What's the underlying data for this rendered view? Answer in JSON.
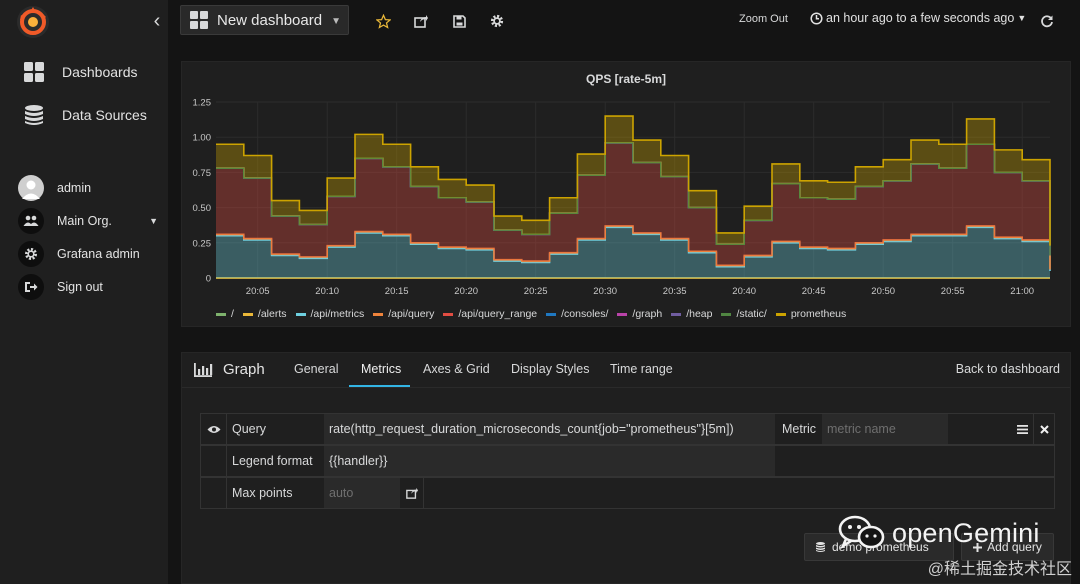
{
  "sidebar": {
    "nav": [
      {
        "label": "Dashboards",
        "icon": "dashboards-grid-icon"
      },
      {
        "label": "Data Sources",
        "icon": "database-icon"
      }
    ],
    "user": [
      {
        "label": "admin",
        "icon": "avatar"
      },
      {
        "label": "Main Org.",
        "icon": "users-icon"
      },
      {
        "label": "Grafana admin",
        "icon": "gear-icon"
      },
      {
        "label": "Sign out",
        "icon": "sign-out-icon"
      }
    ]
  },
  "topbar": {
    "dashboard_title": "New dashboard",
    "zoom_out": "Zoom Out",
    "time_range": "an hour ago to a few seconds ago"
  },
  "panel": {
    "title": "QPS [rate-5m]"
  },
  "chart_data": {
    "type": "area",
    "title": "QPS [rate-5m]",
    "stacked": true,
    "grid": true,
    "legend_position": "bottom",
    "ylim": [
      0,
      1.25
    ],
    "y_ticks": [
      "0",
      "0.25",
      "0.50",
      "0.75",
      "1.00",
      "1.25"
    ],
    "x_ticks": [
      "20:05",
      "20:10",
      "20:15",
      "20:20",
      "20:25",
      "20:30",
      "20:35",
      "20:40",
      "20:45",
      "20:50",
      "20:55",
      "21:00"
    ],
    "x": [
      "20:02",
      "20:04",
      "20:06",
      "20:08",
      "20:10",
      "20:12",
      "20:14",
      "20:16",
      "20:18",
      "20:20",
      "20:22",
      "20:24",
      "20:26",
      "20:28",
      "20:30",
      "20:32",
      "20:34",
      "20:36",
      "20:38",
      "20:40",
      "20:42",
      "20:44",
      "20:46",
      "20:48",
      "20:50",
      "20:52",
      "20:54",
      "20:56",
      "20:58",
      "21:00",
      "21:02"
    ],
    "series": [
      {
        "name": "/",
        "color": "#7eb26d",
        "values": [
          0,
          0,
          0,
          0,
          0,
          0,
          0,
          0,
          0,
          0,
          0,
          0,
          0,
          0,
          0,
          0,
          0,
          0,
          0,
          0,
          0,
          0,
          0,
          0,
          0,
          0,
          0,
          0,
          0,
          0,
          0
        ]
      },
      {
        "name": "/alerts",
        "color": "#eab839",
        "values": [
          0,
          0,
          0,
          0,
          0,
          0,
          0,
          0,
          0,
          0,
          0,
          0,
          0,
          0,
          0,
          0,
          0,
          0,
          0,
          0,
          0,
          0,
          0,
          0,
          0,
          0,
          0,
          0,
          0,
          0,
          0
        ]
      },
      {
        "name": "/api/metrics",
        "color": "#6ed0e0",
        "values": [
          0.3,
          0.27,
          0.16,
          0.14,
          0.22,
          0.32,
          0.3,
          0.24,
          0.21,
          0.2,
          0.12,
          0.11,
          0.17,
          0.27,
          0.36,
          0.31,
          0.27,
          0.18,
          0.08,
          0.15,
          0.25,
          0.21,
          0.2,
          0.24,
          0.26,
          0.3,
          0.3,
          0.36,
          0.28,
          0.26,
          0.05
        ]
      },
      {
        "name": "/api/query",
        "color": "#ef843c",
        "values": [
          0.01,
          0.01,
          0.01,
          0.01,
          0.01,
          0.01,
          0.01,
          0.01,
          0.01,
          0.01,
          0.01,
          0.01,
          0.01,
          0.01,
          0.01,
          0.01,
          0.01,
          0.01,
          0.01,
          0.01,
          0.01,
          0.01,
          0.01,
          0.01,
          0.01,
          0.01,
          0.01,
          0.01,
          0.01,
          0.01,
          0.01
        ]
      },
      {
        "name": "/api/query_range",
        "color": "#e24d42",
        "values": [
          0.47,
          0.43,
          0.27,
          0.23,
          0.35,
          0.52,
          0.48,
          0.4,
          0.35,
          0.33,
          0.21,
          0.19,
          0.28,
          0.45,
          0.59,
          0.5,
          0.44,
          0.31,
          0.15,
          0.25,
          0.41,
          0.35,
          0.35,
          0.4,
          0.42,
          0.5,
          0.47,
          0.58,
          0.46,
          0.42,
          0.1
        ]
      },
      {
        "name": "/consoles/",
        "color": "#1f78c1",
        "values": [
          0,
          0,
          0,
          0,
          0,
          0,
          0,
          0,
          0,
          0,
          0,
          0,
          0,
          0,
          0,
          0,
          0,
          0,
          0,
          0,
          0,
          0,
          0,
          0,
          0,
          0,
          0,
          0,
          0,
          0,
          0
        ]
      },
      {
        "name": "/graph",
        "color": "#ba43a9",
        "values": [
          0,
          0,
          0,
          0,
          0,
          0,
          0,
          0,
          0,
          0,
          0,
          0,
          0,
          0,
          0,
          0,
          0,
          0,
          0,
          0,
          0,
          0,
          0,
          0,
          0,
          0,
          0,
          0,
          0,
          0,
          0
        ]
      },
      {
        "name": "/heap",
        "color": "#705da0",
        "values": [
          0,
          0,
          0,
          0,
          0,
          0,
          0,
          0,
          0,
          0,
          0,
          0,
          0,
          0,
          0,
          0,
          0,
          0,
          0,
          0,
          0,
          0,
          0,
          0,
          0,
          0,
          0,
          0,
          0,
          0,
          0
        ]
      },
      {
        "name": "/static/",
        "color": "#508642",
        "values": [
          0,
          0,
          0,
          0,
          0,
          0,
          0,
          0,
          0,
          0,
          0,
          0,
          0,
          0,
          0,
          0,
          0,
          0,
          0,
          0,
          0,
          0,
          0,
          0,
          0,
          0,
          0,
          0,
          0,
          0,
          0
        ]
      },
      {
        "name": "prometheus",
        "color": "#cca300",
        "values": [
          0.17,
          0.16,
          0.11,
          0.1,
          0.13,
          0.17,
          0.16,
          0.14,
          0.13,
          0.12,
          0.1,
          0.1,
          0.11,
          0.15,
          0.19,
          0.16,
          0.15,
          0.12,
          0.08,
          0.1,
          0.14,
          0.12,
          0.12,
          0.14,
          0.15,
          0.17,
          0.17,
          0.18,
          0.16,
          0.15,
          0.07
        ]
      }
    ]
  },
  "editor": {
    "title": "Graph",
    "tabs": [
      "General",
      "Metrics",
      "Axes & Grid",
      "Display Styles",
      "Time range"
    ],
    "active_tab": "Metrics",
    "back": "Back to dashboard",
    "query_label": "Query",
    "query_value": "rate(http_request_duration_microseconds_count{job=\"prometheus\"}[5m])",
    "metric_label": "Metric",
    "metric_placeholder": "metric name",
    "legend_label": "Legend format",
    "legend_value": "{{handler}}",
    "maxpoints_label": "Max points",
    "maxpoints_placeholder": "auto",
    "datasource": "demo prometheus",
    "add_query": "Add query"
  },
  "watermark": {
    "brand": "openGemini",
    "site": "@稀土掘金技术社区"
  }
}
